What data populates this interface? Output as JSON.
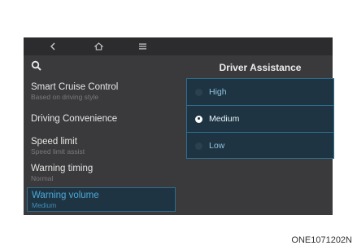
{
  "screen": {
    "topbar": {
      "back_icon": "chevron-left-icon",
      "home_icon": "home-icon",
      "menu_icon": "hamburger-menu-icon"
    },
    "search_icon": "search-icon",
    "menu": [
      {
        "title": "Smart Cruise Control",
        "subtitle": "Based on driving style"
      },
      {
        "title": "Driving Convenience",
        "subtitle": ""
      },
      {
        "title": "Speed limit",
        "subtitle": "Speed limit assist"
      },
      {
        "title": "Warning timing",
        "subtitle": "Normal"
      },
      {
        "title": "Warning volume",
        "subtitle": "Medium",
        "selected": true
      }
    ],
    "panel": {
      "title": "Driver Assistance",
      "options": [
        {
          "label": "High",
          "checked": false
        },
        {
          "label": "Medium",
          "checked": true
        },
        {
          "label": "Low",
          "checked": false
        }
      ]
    }
  },
  "image_code": "ONE1071202N",
  "colors": {
    "accent": "#2f6e8d",
    "screen_bg": "#3a3a3c",
    "popup_bg": "#1e3442"
  }
}
